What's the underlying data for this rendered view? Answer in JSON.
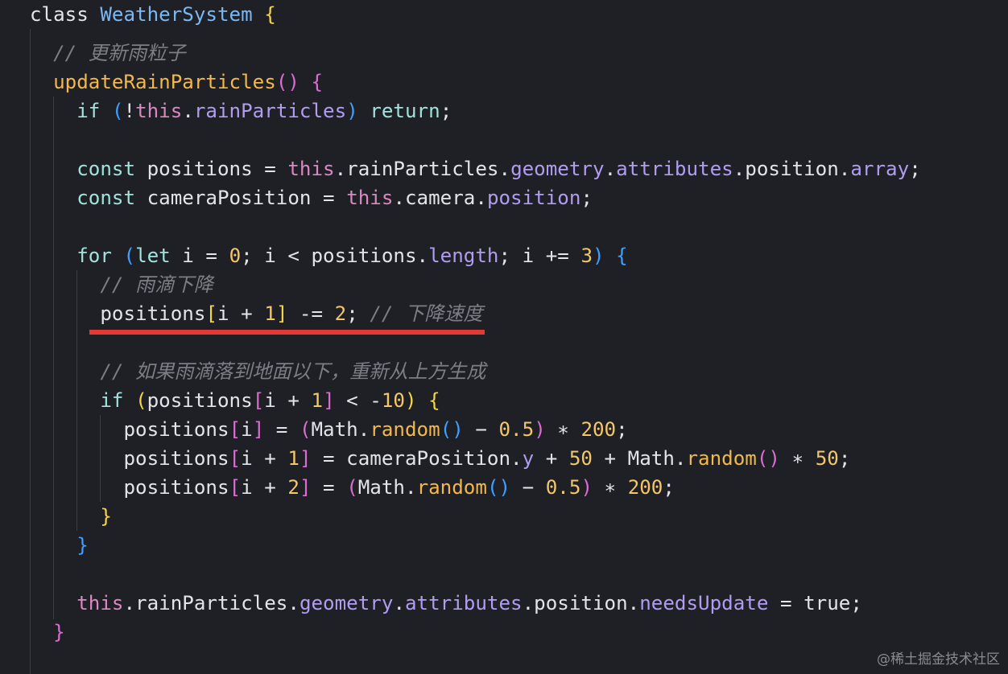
{
  "editor": {
    "lines": [
      [
        {
          "t": "class ",
          "c": "kw-s"
        },
        {
          "t": "WeatherSystem",
          "c": "cls"
        },
        {
          "t": " ",
          "c": ""
        },
        {
          "t": "{",
          "c": "b1"
        }
      ],
      [],
      [
        {
          "t": "  // 更新雨粒子",
          "c": "cmt"
        }
      ],
      [
        {
          "t": "  ",
          "c": ""
        },
        {
          "t": "updateRainParticles",
          "c": "fn"
        },
        {
          "t": "()",
          "c": "b2"
        },
        {
          "t": " ",
          "c": ""
        },
        {
          "t": "{",
          "c": "b2"
        }
      ],
      [
        {
          "t": "    ",
          "c": ""
        },
        {
          "t": "if",
          "c": "ctl"
        },
        {
          "t": " ",
          "c": ""
        },
        {
          "t": "(",
          "c": "b3"
        },
        {
          "t": "!",
          "c": ""
        },
        {
          "t": "this",
          "c": "this"
        },
        {
          "t": ".",
          "c": ""
        },
        {
          "t": "rainParticles",
          "c": "prop"
        },
        {
          "t": ")",
          "c": "b3"
        },
        {
          "t": " ",
          "c": ""
        },
        {
          "t": "return",
          "c": "ctl"
        },
        {
          "t": ";",
          "c": ""
        }
      ],
      [],
      [
        {
          "t": "    ",
          "c": ""
        },
        {
          "t": "const",
          "c": "ctl"
        },
        {
          "t": " positions = ",
          "c": ""
        },
        {
          "t": "this",
          "c": "this"
        },
        {
          "t": ".rainParticles.",
          "c": ""
        },
        {
          "t": "geometry",
          "c": "prop"
        },
        {
          "t": ".",
          "c": ""
        },
        {
          "t": "attributes",
          "c": "prop"
        },
        {
          "t": ".position.",
          "c": ""
        },
        {
          "t": "array",
          "c": "prop"
        },
        {
          "t": ";",
          "c": ""
        }
      ],
      [
        {
          "t": "    ",
          "c": ""
        },
        {
          "t": "const",
          "c": "ctl"
        },
        {
          "t": " cameraPosition = ",
          "c": ""
        },
        {
          "t": "this",
          "c": "this"
        },
        {
          "t": ".camera.",
          "c": ""
        },
        {
          "t": "position",
          "c": "prop"
        },
        {
          "t": ";",
          "c": ""
        }
      ],
      [],
      [
        {
          "t": "    ",
          "c": ""
        },
        {
          "t": "for",
          "c": "ctl"
        },
        {
          "t": " ",
          "c": ""
        },
        {
          "t": "(",
          "c": "b3"
        },
        {
          "t": "let",
          "c": "ctl"
        },
        {
          "t": " i = ",
          "c": ""
        },
        {
          "t": "0",
          "c": "num"
        },
        {
          "t": "; i < positions.",
          "c": ""
        },
        {
          "t": "length",
          "c": "prop"
        },
        {
          "t": "; i += ",
          "c": ""
        },
        {
          "t": "3",
          "c": "num"
        },
        {
          "t": ")",
          "c": "b3"
        },
        {
          "t": " ",
          "c": ""
        },
        {
          "t": "{",
          "c": "b3"
        }
      ],
      [
        {
          "t": "      // 雨滴下降",
          "c": "cmt"
        }
      ],
      [
        {
          "t": "      positions",
          "c": ""
        },
        {
          "t": "[",
          "c": "b1"
        },
        {
          "t": "i + ",
          "c": ""
        },
        {
          "t": "1",
          "c": "num"
        },
        {
          "t": "]",
          "c": "b1"
        },
        {
          "t": " -= ",
          "c": ""
        },
        {
          "t": "2",
          "c": "num"
        },
        {
          "t": "; ",
          "c": ""
        },
        {
          "t": "// 下降速度",
          "c": "cmt"
        }
      ],
      [],
      [
        {
          "t": "      // 如果雨滴落到地面以下，重新从上方生成",
          "c": "cmt"
        }
      ],
      [
        {
          "t": "      ",
          "c": ""
        },
        {
          "t": "if",
          "c": "ctl"
        },
        {
          "t": " ",
          "c": ""
        },
        {
          "t": "(",
          "c": "b1"
        },
        {
          "t": "positions",
          "c": ""
        },
        {
          "t": "[",
          "c": "b2"
        },
        {
          "t": "i + ",
          "c": ""
        },
        {
          "t": "1",
          "c": "num"
        },
        {
          "t": "]",
          "c": "b2"
        },
        {
          "t": " < -",
          "c": ""
        },
        {
          "t": "10",
          "c": "num"
        },
        {
          "t": ")",
          "c": "b1"
        },
        {
          "t": " ",
          "c": ""
        },
        {
          "t": "{",
          "c": "b1"
        }
      ],
      [
        {
          "t": "        positions",
          "c": ""
        },
        {
          "t": "[",
          "c": "b2"
        },
        {
          "t": "i",
          "c": ""
        },
        {
          "t": "]",
          "c": "b2"
        },
        {
          "t": " = ",
          "c": ""
        },
        {
          "t": "(",
          "c": "b2"
        },
        {
          "t": "Math.",
          "c": ""
        },
        {
          "t": "random",
          "c": "fn"
        },
        {
          "t": "()",
          "c": "b3"
        },
        {
          "t": " − ",
          "c": ""
        },
        {
          "t": "0.5",
          "c": "num"
        },
        {
          "t": ")",
          "c": "b2"
        },
        {
          "t": " ∗ ",
          "c": ""
        },
        {
          "t": "200",
          "c": "num"
        },
        {
          "t": ";",
          "c": ""
        }
      ],
      [
        {
          "t": "        positions",
          "c": ""
        },
        {
          "t": "[",
          "c": "b2"
        },
        {
          "t": "i + ",
          "c": ""
        },
        {
          "t": "1",
          "c": "num"
        },
        {
          "t": "]",
          "c": "b2"
        },
        {
          "t": " = cameraPosition.",
          "c": ""
        },
        {
          "t": "y",
          "c": "prop"
        },
        {
          "t": " + ",
          "c": ""
        },
        {
          "t": "50",
          "c": "num"
        },
        {
          "t": " + Math.",
          "c": ""
        },
        {
          "t": "random",
          "c": "fn"
        },
        {
          "t": "()",
          "c": "b2"
        },
        {
          "t": " ∗ ",
          "c": ""
        },
        {
          "t": "50",
          "c": "num"
        },
        {
          "t": ";",
          "c": ""
        }
      ],
      [
        {
          "t": "        positions",
          "c": ""
        },
        {
          "t": "[",
          "c": "b2"
        },
        {
          "t": "i + ",
          "c": ""
        },
        {
          "t": "2",
          "c": "num"
        },
        {
          "t": "]",
          "c": "b2"
        },
        {
          "t": " = ",
          "c": ""
        },
        {
          "t": "(",
          "c": "b2"
        },
        {
          "t": "Math.",
          "c": ""
        },
        {
          "t": "random",
          "c": "fn"
        },
        {
          "t": "()",
          "c": "b3"
        },
        {
          "t": " − ",
          "c": ""
        },
        {
          "t": "0.5",
          "c": "num"
        },
        {
          "t": ")",
          "c": "b2"
        },
        {
          "t": " ∗ ",
          "c": ""
        },
        {
          "t": "200",
          "c": "num"
        },
        {
          "t": ";",
          "c": ""
        }
      ],
      [
        {
          "t": "      ",
          "c": ""
        },
        {
          "t": "}",
          "c": "b1"
        }
      ],
      [
        {
          "t": "    ",
          "c": ""
        },
        {
          "t": "}",
          "c": "b3"
        }
      ],
      [],
      [
        {
          "t": "    ",
          "c": ""
        },
        {
          "t": "this",
          "c": "this"
        },
        {
          "t": ".rainParticles.",
          "c": ""
        },
        {
          "t": "geometry",
          "c": "prop"
        },
        {
          "t": ".",
          "c": ""
        },
        {
          "t": "attributes",
          "c": "prop"
        },
        {
          "t": ".position.",
          "c": ""
        },
        {
          "t": "needsUpdate",
          "c": "prop"
        },
        {
          "t": " = true;",
          "c": ""
        }
      ],
      [
        {
          "t": "  ",
          "c": ""
        },
        {
          "t": "}",
          "c": "b2"
        }
      ]
    ]
  },
  "watermark": "@稀土掘金技术社区"
}
